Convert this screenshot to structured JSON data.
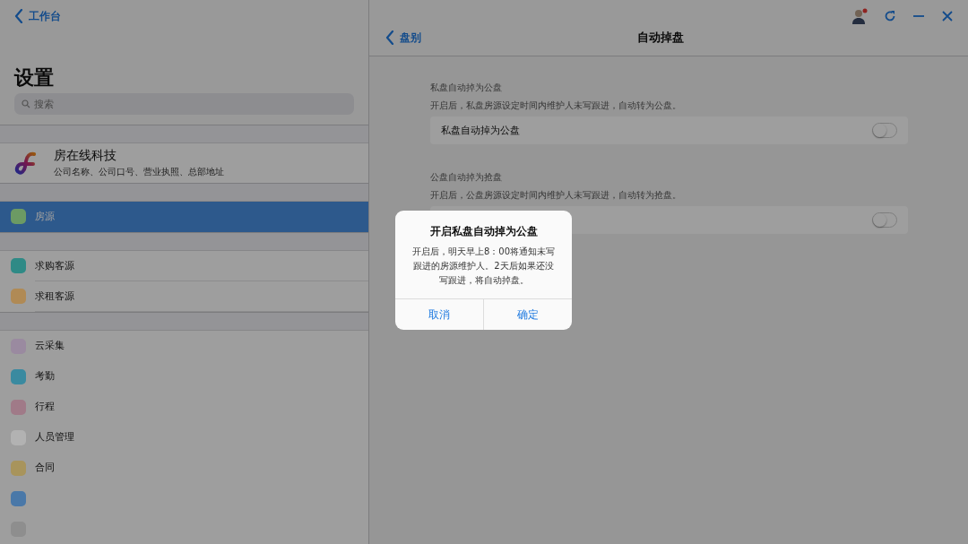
{
  "sidebar": {
    "back_label": "工作台",
    "title": "设置",
    "search": {
      "placeholder": "搜索"
    },
    "company": {
      "name": "房在线科技",
      "subtitle": "公司名称、公司口号、营业执照、总部地址"
    },
    "groups": [
      [
        {
          "label": "房源",
          "selected": true,
          "color": "#6c9a64"
        }
      ],
      [
        {
          "label": "求购客源",
          "selected": false,
          "color": "#2f8a86"
        },
        {
          "label": "求租客源",
          "selected": false,
          "color": "#b08a55"
        }
      ],
      [
        {
          "label": "云采集",
          "selected": false,
          "color": "#9a8aa0"
        },
        {
          "label": "考勤",
          "selected": false,
          "color": "#3a8aa0"
        },
        {
          "label": "行程",
          "selected": false,
          "color": "#a07a88"
        },
        {
          "label": "人员管理",
          "selected": false,
          "color": "#b2b2b2"
        },
        {
          "label": "合同",
          "selected": false,
          "color": "#a8945c"
        },
        {
          "selected": false,
          "color": "#4a78a8"
        },
        {
          "selected": false,
          "color": "#8e8e8e"
        }
      ]
    ]
  },
  "detail": {
    "back_label": "盘别",
    "title": "自动掉盘",
    "sections": [
      {
        "label": "私盘自动掉为公盘",
        "description": "开启后，私盘房源设定时间内维护人未写跟进，自动转为公盘。",
        "row_label": "私盘自动掉为公盘",
        "on": false
      },
      {
        "label": "公盘自动掉为抢盘",
        "description": "开启后，公盘房源设定时间内维护人未写跟进，自动转为抢盘。",
        "on": false
      }
    ]
  },
  "dialog": {
    "title": "开启私盘自动掉为公盘",
    "message": "开启后，明天早上8：00将通知未写跟进的房源维护人。2天后如果还没写跟进，将自动掉盘。",
    "buttons": [
      "取消",
      "确定"
    ]
  }
}
